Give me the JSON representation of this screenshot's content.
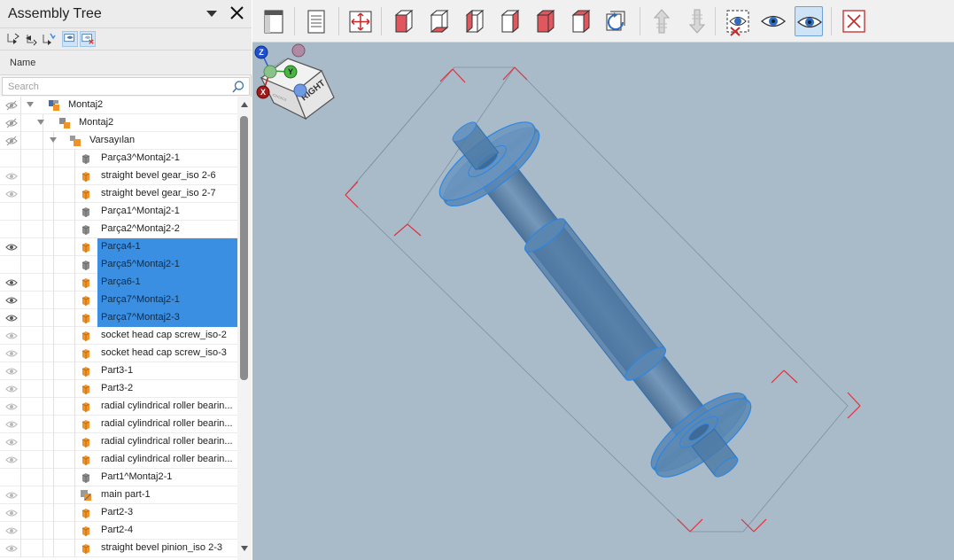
{
  "panel": {
    "title": "Assembly Tree",
    "column_header": "Name",
    "search_placeholder": "Search"
  },
  "tree": [
    {
      "label": "Montaj2",
      "level": 0,
      "icon": "assembly-root-icon",
      "eye": "hidden",
      "expanded": true,
      "selected": false
    },
    {
      "label": "Montaj2",
      "level": 1,
      "icon": "assembly-icon",
      "eye": "hidden",
      "expanded": true,
      "selected": false
    },
    {
      "label": "Varsayılan",
      "level": 2,
      "icon": "configuration-icon",
      "eye": "hidden",
      "expanded": true,
      "selected": false
    },
    {
      "label": "Parça3^Montaj2-1",
      "level": 3,
      "icon": "part-gray-icon",
      "eye": "none",
      "selected": false
    },
    {
      "label": "straight bevel gear_iso 2-6",
      "level": 3,
      "icon": "part-orange-icon",
      "eye": "faint",
      "selected": false
    },
    {
      "label": "straight bevel gear_iso 2-7",
      "level": 3,
      "icon": "part-orange-icon",
      "eye": "faint",
      "selected": false
    },
    {
      "label": "Parça1^Montaj2-1",
      "level": 3,
      "icon": "part-gray-icon",
      "eye": "none",
      "selected": false
    },
    {
      "label": "Parça2^Montaj2-2",
      "level": 3,
      "icon": "part-gray-icon",
      "eye": "none",
      "selected": false
    },
    {
      "label": "Parça4-1",
      "level": 3,
      "icon": "part-orange-icon",
      "eye": "visible",
      "selected": true
    },
    {
      "label": "Parça5^Montaj2-1",
      "level": 3,
      "icon": "part-gray-icon",
      "eye": "none",
      "selected": true
    },
    {
      "label": "Parça6-1",
      "level": 3,
      "icon": "part-orange-icon",
      "eye": "visible",
      "selected": true
    },
    {
      "label": "Parça7^Montaj2-1",
      "level": 3,
      "icon": "part-orange-icon",
      "eye": "visible",
      "selected": true
    },
    {
      "label": "Parça7^Montaj2-3",
      "level": 3,
      "icon": "part-orange-icon",
      "eye": "visible",
      "selected": true
    },
    {
      "label": "socket head cap screw_iso-2",
      "level": 3,
      "icon": "part-orange-icon",
      "eye": "faint",
      "selected": false
    },
    {
      "label": "socket head cap screw_iso-3",
      "level": 3,
      "icon": "part-orange-icon",
      "eye": "faint",
      "selected": false
    },
    {
      "label": "Part3-1",
      "level": 3,
      "icon": "part-orange-icon",
      "eye": "faint",
      "selected": false
    },
    {
      "label": "Part3-2",
      "level": 3,
      "icon": "part-orange-icon",
      "eye": "faint",
      "selected": false
    },
    {
      "label": "radial cylindrical roller bearin...",
      "level": 3,
      "icon": "part-orange-icon",
      "eye": "faint",
      "selected": false
    },
    {
      "label": "radial cylindrical roller bearin...",
      "level": 3,
      "icon": "part-orange-icon",
      "eye": "faint",
      "selected": false
    },
    {
      "label": "radial cylindrical roller bearin...",
      "level": 3,
      "icon": "part-orange-icon",
      "eye": "faint",
      "selected": false
    },
    {
      "label": "radial cylindrical roller bearin...",
      "level": 3,
      "icon": "part-orange-icon",
      "eye": "faint",
      "selected": false
    },
    {
      "label": "Part1^Montaj2-1",
      "level": 3,
      "icon": "part-gray-icon",
      "eye": "none",
      "selected": false
    },
    {
      "label": "main part-1",
      "level": 3,
      "icon": "subassembly-icon",
      "eye": "faint",
      "selected": false
    },
    {
      "label": "Part2-3",
      "level": 3,
      "icon": "part-orange-icon",
      "eye": "faint",
      "selected": false
    },
    {
      "label": "Part2-4",
      "level": 3,
      "icon": "part-orange-icon",
      "eye": "faint",
      "selected": false
    },
    {
      "label": "straight bevel pinion_iso 2-3",
      "level": 3,
      "icon": "part-orange-icon",
      "eye": "faint",
      "selected": false
    }
  ],
  "toolbar": {
    "buttons": [
      {
        "name": "panel-toggle-icon",
        "active": false
      },
      {
        "name": "document-icon",
        "active": false
      },
      {
        "name": "fit-all-icon",
        "active": false
      },
      {
        "name": "view-front-cube-icon",
        "active": false
      },
      {
        "name": "view-bottom-cube-icon",
        "active": false
      },
      {
        "name": "view-left-cube-icon",
        "active": false
      },
      {
        "name": "view-right-cube-icon",
        "active": false
      },
      {
        "name": "view-back-cube-icon",
        "active": false
      },
      {
        "name": "view-top-cube-icon",
        "active": false
      },
      {
        "name": "rotate-view-icon",
        "active": false
      },
      {
        "name": "explode-up-icon",
        "active": false
      },
      {
        "name": "explode-down-icon",
        "active": false
      },
      {
        "name": "hide-selected-icon",
        "active": false
      },
      {
        "name": "show-icon",
        "active": false
      },
      {
        "name": "show-selected-only-icon",
        "active": true
      },
      {
        "name": "close-view-icon",
        "active": false
      }
    ]
  },
  "viewcube": {
    "face_label": "RIGHT"
  },
  "triad": {
    "x": "X",
    "y": "Y",
    "z": "Z"
  },
  "colors": {
    "selection": "#3b8fe2",
    "viewport_bg": "#a9bac9",
    "part_blue": "#4a79a6",
    "bounding_box": "#e0303a",
    "part_orange": "#f0922a"
  }
}
